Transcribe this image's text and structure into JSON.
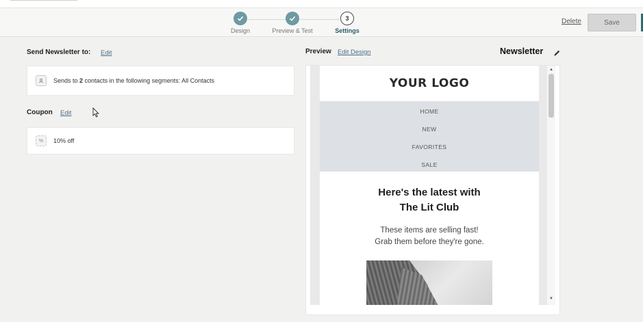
{
  "stepper": {
    "steps": [
      {
        "label": "Design",
        "state": "done"
      },
      {
        "label": "Preview & Test",
        "state": "done"
      },
      {
        "label": "Settings",
        "state": "current",
        "number": "3"
      }
    ]
  },
  "actions": {
    "delete_label": "Delete",
    "save_label": "Save"
  },
  "send_section": {
    "title": "Send Newsletter to:",
    "edit_label": "Edit",
    "summary_prefix": "Sends to ",
    "contact_count": "2",
    "summary_suffix": " contacts in the following segments: All Contacts"
  },
  "coupon_section": {
    "title": "Coupon",
    "edit_label": "Edit",
    "value": "10% off"
  },
  "preview": {
    "label": "Preview",
    "edit_label": "Edit Design",
    "newsletter_title": "Newsletter"
  },
  "email": {
    "logo_text": "YOUR LOGO",
    "nav_items": [
      "HOME",
      "NEW",
      "FAVORITES",
      "SALE"
    ],
    "headline_line1": "Here's the latest with",
    "headline_line2": "The Lit Club",
    "sub_line1": "These items are selling fast!",
    "sub_line2": "Grab them before they're gone."
  },
  "colors": {
    "step_done": "#6e9aa3",
    "step_current_label": "#2f5966",
    "link": "#4e6e86",
    "nav_bg": "#dde0e4",
    "accent_edge": "#2c6e6e"
  },
  "icons": {
    "step_done": "check-icon",
    "segment": "contacts-icon",
    "coupon": "coupon-icon",
    "rename": "pencil-icon",
    "cursor": "mouse-pointer-icon"
  }
}
